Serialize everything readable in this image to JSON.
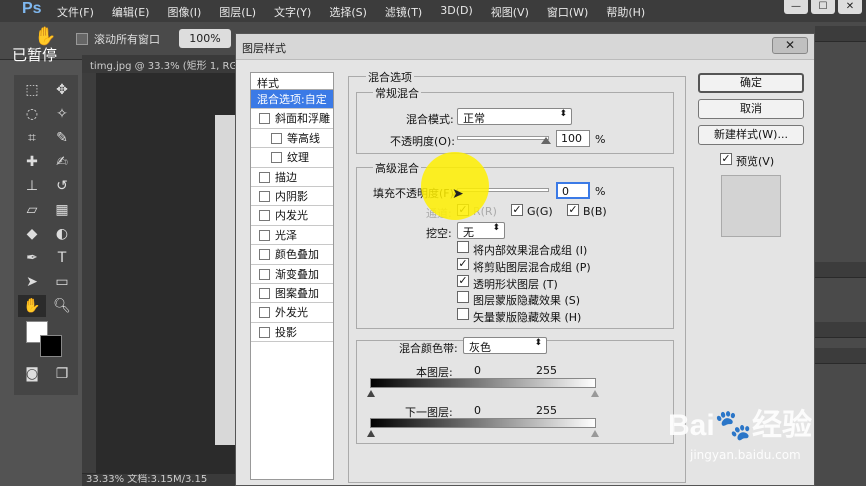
{
  "app": {
    "logo": "Ps",
    "menu": [
      "文件(F)",
      "编辑(E)",
      "图像(I)",
      "图层(L)",
      "文字(Y)",
      "选择(S)",
      "滤镜(T)",
      "3D(D)",
      "视图(V)",
      "窗口(W)",
      "帮助(H)"
    ],
    "window_buttons": [
      "—",
      "☐",
      "✕"
    ],
    "paused_label": "已暂停",
    "options": {
      "scroll_all_label": "滚动所有窗口",
      "zoom_button": "100%"
    },
    "doc_tab": "timg.jpg @ 33.3% (矩形 1, RGB",
    "status": "33.33%    文档:3.15M/3.15"
  },
  "dialog": {
    "title": "图层样式",
    "close": "✕",
    "style_list": {
      "header": "样式",
      "items": [
        {
          "label": "混合选项:自定",
          "selected": true,
          "checkbox": false,
          "sub": false
        },
        {
          "label": "斜面和浮雕",
          "selected": false,
          "checkbox": true,
          "sub": false
        },
        {
          "label": "等高线",
          "selected": false,
          "checkbox": true,
          "sub": true
        },
        {
          "label": "纹理",
          "selected": false,
          "checkbox": true,
          "sub": true
        },
        {
          "label": "描边",
          "selected": false,
          "checkbox": true,
          "sub": false
        },
        {
          "label": "内阴影",
          "selected": false,
          "checkbox": true,
          "sub": false
        },
        {
          "label": "内发光",
          "selected": false,
          "checkbox": true,
          "sub": false
        },
        {
          "label": "光泽",
          "selected": false,
          "checkbox": true,
          "sub": false
        },
        {
          "label": "颜色叠加",
          "selected": false,
          "checkbox": true,
          "sub": false
        },
        {
          "label": "渐变叠加",
          "selected": false,
          "checkbox": true,
          "sub": false
        },
        {
          "label": "图案叠加",
          "selected": false,
          "checkbox": true,
          "sub": false
        },
        {
          "label": "外发光",
          "selected": false,
          "checkbox": true,
          "sub": false
        },
        {
          "label": "投影",
          "selected": false,
          "checkbox": true,
          "sub": false
        }
      ]
    },
    "blend_options": {
      "title": "混合选项",
      "general": {
        "title": "常规混合",
        "mode_label": "混合模式:",
        "mode_value": "正常",
        "opacity_label": "不透明度(O):",
        "opacity_value": "100",
        "opacity_unit": "%"
      },
      "advanced": {
        "title": "高级混合",
        "fill_label": "填充不透明度(F):",
        "fill_value": "0",
        "fill_unit": "%",
        "channels_label": "通道:",
        "channels": [
          {
            "label": "R(R)",
            "checked": true
          },
          {
            "label": "G(G)",
            "checked": true
          },
          {
            "label": "B(B)",
            "checked": true
          }
        ],
        "knockout_label": "挖空:",
        "knockout_value": "无",
        "options": [
          {
            "label": "将内部效果混合成组 (I)",
            "checked": false
          },
          {
            "label": "将剪贴图层混合成组 (P)",
            "checked": true
          },
          {
            "label": "透明形状图层 (T)",
            "checked": true
          },
          {
            "label": "图层蒙版隐藏效果 (S)",
            "checked": false
          },
          {
            "label": "矢量蒙版隐藏效果 (H)",
            "checked": false
          }
        ]
      },
      "blend_if": {
        "label": "混合颜色带:",
        "value": "灰色",
        "this_layer": {
          "label": "本图层:",
          "low": "0",
          "high": "255"
        },
        "underlying": {
          "label": "下一图层:",
          "low": "0",
          "high": "255"
        }
      }
    },
    "buttons": {
      "ok": "确定",
      "cancel": "取消",
      "new_style": "新建样式(W)..."
    },
    "preview": {
      "label": "预览(V)",
      "checked": true
    }
  },
  "watermark": {
    "text": "Bai🐾经验",
    "url": "jingyan.baidu.com"
  }
}
